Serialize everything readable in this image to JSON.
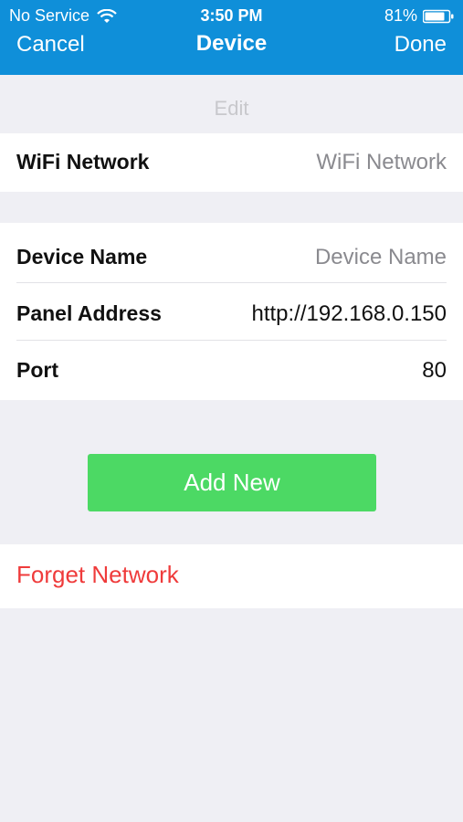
{
  "status_bar": {
    "carrier": "No Service",
    "time": "3:50 PM",
    "battery": "81%"
  },
  "nav": {
    "cancel": "Cancel",
    "title": "Device",
    "done": "Done"
  },
  "edit_label": "Edit",
  "wifi_row": {
    "label": "WiFi Network",
    "placeholder": "WiFi Network"
  },
  "device_section": {
    "device_name": {
      "label": "Device Name",
      "placeholder": "Device Name"
    },
    "panel_address": {
      "label": "Panel Address",
      "value": "http://192.168.0.150"
    },
    "port": {
      "label": "Port",
      "value": "80"
    }
  },
  "add_button": "Add New",
  "forget_network": "Forget Network",
  "colors": {
    "header": "#0f8fd9",
    "add_button": "#4cd964",
    "destructive": "#ef3b3b",
    "background": "#efeff4"
  }
}
